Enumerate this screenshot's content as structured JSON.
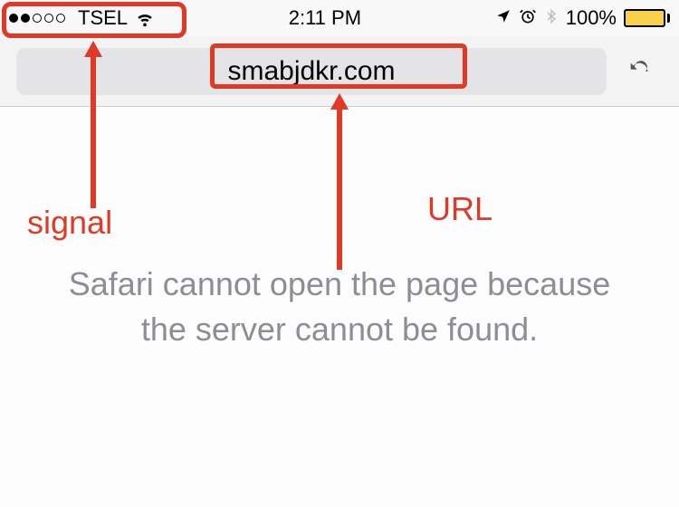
{
  "status": {
    "carrier": "TSEL",
    "signal_strength": 2,
    "signal_max": 5,
    "wifi": true,
    "time": "2:11 PM",
    "location": true,
    "alarm": true,
    "bluetooth": true,
    "battery_percent": "100%"
  },
  "url_bar": {
    "domain": "smabjdkr.com",
    "reload_glyph": "↻"
  },
  "error": {
    "message": "Safari cannot open the page because the server cannot be found."
  },
  "annotations": {
    "signal_label": "signal",
    "url_label": "URL",
    "box_color": "#e03a27"
  }
}
